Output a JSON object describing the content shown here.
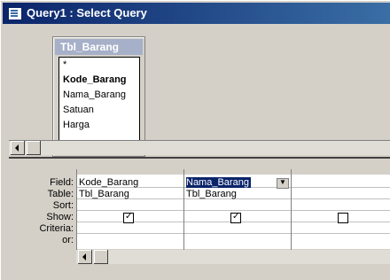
{
  "window": {
    "title": "Query1 : Select Query"
  },
  "table": {
    "name": "Tbl_Barang",
    "fields": [
      "*",
      "Kode_Barang",
      "Nama_Barang",
      "Satuan",
      "Harga"
    ]
  },
  "grid": {
    "row_labels": {
      "field": "Field:",
      "table": "Table:",
      "sort": "Sort:",
      "show": "Show:",
      "criteria": "Criteria:",
      "or": "or:"
    },
    "columns": [
      {
        "field": "Kode_Barang",
        "table": "Tbl_Barang",
        "show": true
      },
      {
        "field": "Nama_Barang",
        "table": "Tbl_Barang",
        "show": true
      },
      {
        "field": "",
        "table": "",
        "show": false
      }
    ]
  }
}
